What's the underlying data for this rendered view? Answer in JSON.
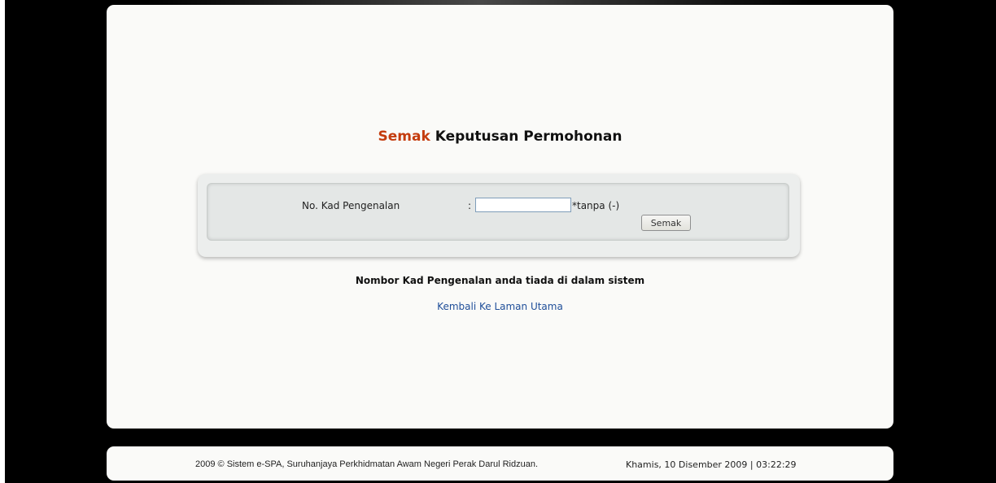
{
  "header": {
    "title_accent": "Semak",
    "title_rest": " Keputusan Permohonan"
  },
  "form": {
    "ic_label": "No. Kad Pengenalan",
    "colon": ":",
    "ic_value": "",
    "ic_hint": "*tanpa (-)",
    "submit_label": "Semak"
  },
  "result": {
    "message": "Nombor Kad Pengenalan anda tiada di dalam sistem",
    "back_link": "Kembali Ke Laman Utama"
  },
  "footer": {
    "copyright": "2009 © Sistem e-SPA, Suruhanjaya Perkhidmatan Awam Negeri Perak Darul Ridzuan.",
    "datetime": "Khamis, 10 Disember 2009 | 03:22:29"
  },
  "colors": {
    "accent": "#c43c0e",
    "link": "#1f4e99",
    "background": "#000000",
    "panel": "#fafaf8"
  }
}
